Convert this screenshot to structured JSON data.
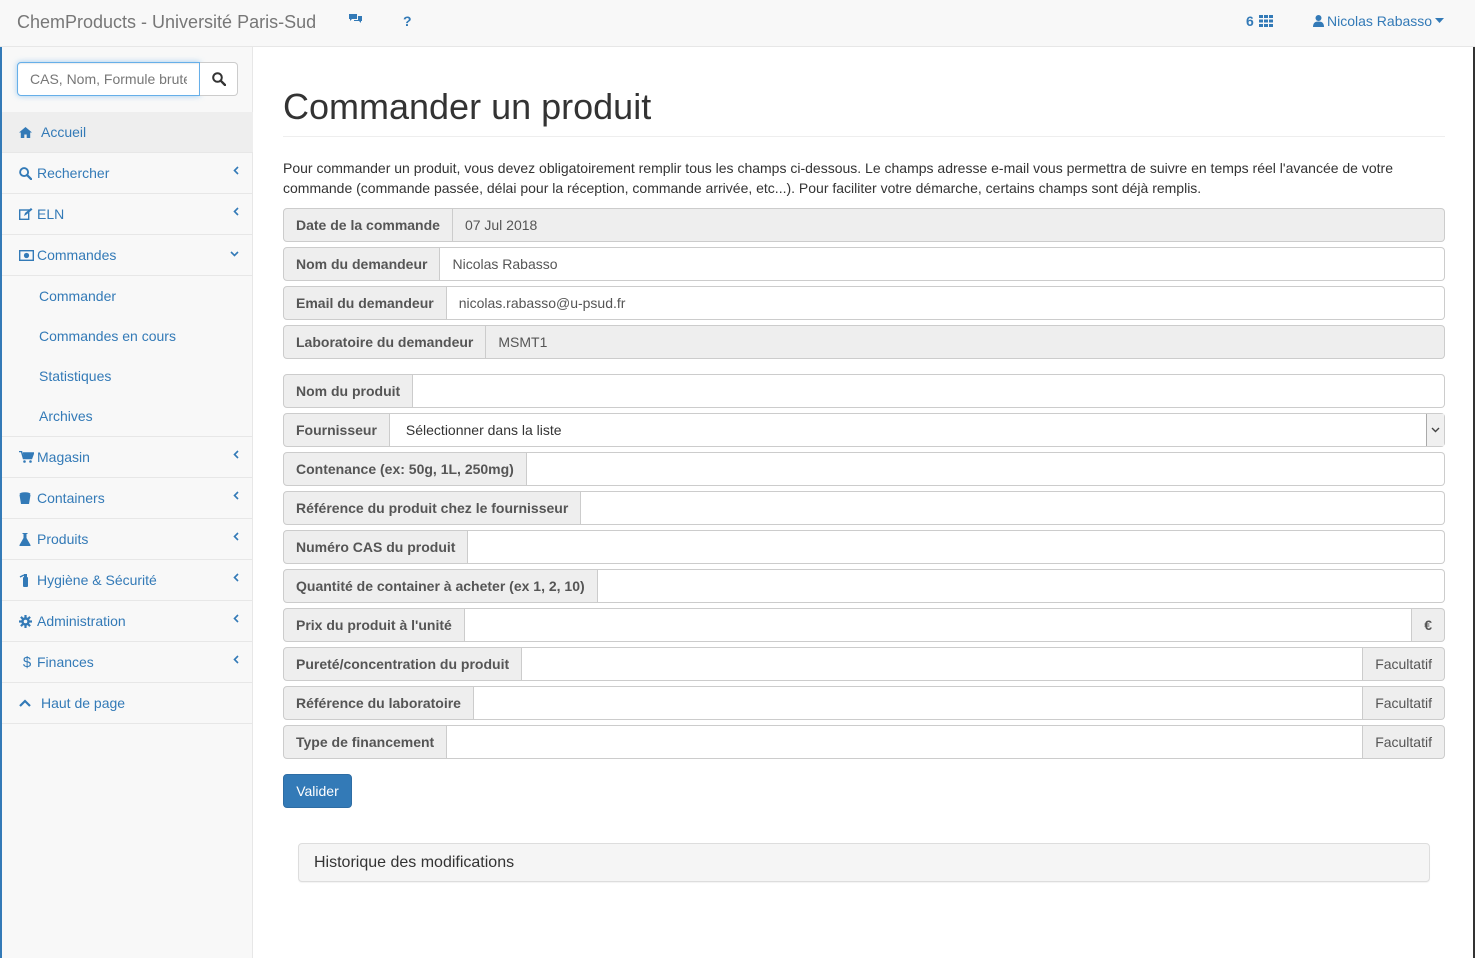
{
  "navbar": {
    "brand": "ChemProducts - Université Paris-Sud",
    "apps_count": "6",
    "user_name": "Nicolas Rabasso",
    "help_label": "?"
  },
  "search": {
    "placeholder": "CAS, Nom, Formule brute"
  },
  "sidebar": {
    "items": [
      {
        "label": "Accueil",
        "icon": "home-icon"
      },
      {
        "label": "Rechercher",
        "icon": "search-icon"
      },
      {
        "label": "ELN",
        "icon": "edit-icon"
      },
      {
        "label": "Commandes",
        "icon": "money-icon"
      },
      {
        "label": "Magasin",
        "icon": "cart-icon"
      },
      {
        "label": "Containers",
        "icon": "bucket-icon"
      },
      {
        "label": "Produits",
        "icon": "flask-icon"
      },
      {
        "label": "Hygiène & Sécurité",
        "icon": "extinguisher-icon"
      },
      {
        "label": "Administration",
        "icon": "gear-icon"
      },
      {
        "label": "Finances",
        "icon": "dollar-icon"
      },
      {
        "label": "Haut de page",
        "icon": "chevron-up-icon"
      }
    ],
    "subitems": [
      "Commander",
      "Commandes en cours",
      "Statistiques",
      "Archives"
    ]
  },
  "main": {
    "title": "Commander un produit",
    "intro": "Pour commander un produit, vous devez obligatoirement remplir tous les champs ci-dessous. Le champs adresse e-mail vous permettra de suivre en temps réel l'avancée de votre commande (commande passée, délai pour la réception, commande arrivée, etc...). Pour faciliter votre démarche, certains champs sont déjà remplis.",
    "fields": {
      "date": {
        "label": "Date de la commande",
        "value": "07 Jul 2018"
      },
      "nom": {
        "label": "Nom du demandeur",
        "value": "Nicolas Rabasso"
      },
      "email": {
        "label": "Email du demandeur",
        "value": "nicolas.rabasso@u-psud.fr"
      },
      "labo": {
        "label": "Laboratoire du demandeur",
        "value": "MSMT1"
      },
      "produit": {
        "label": "Nom du produit",
        "value": ""
      },
      "fournisseur": {
        "label": "Fournisseur",
        "value": "Sélectionner dans la liste"
      },
      "contenance": {
        "label": "Contenance (ex: 50g, 1L, 250mg)",
        "value": ""
      },
      "ref_fournisseur": {
        "label": "Référence du produit chez le fournisseur",
        "value": ""
      },
      "cas": {
        "label": "Numéro CAS du produit",
        "value": ""
      },
      "quantite": {
        "label": "Quantité de container à acheter (ex 1, 2, 10)",
        "value": ""
      },
      "prix": {
        "label": "Prix du produit à l'unité",
        "value": "",
        "addon": "€"
      },
      "purete": {
        "label": "Pureté/concentration du produit",
        "value": "",
        "addon": "Facultatif"
      },
      "ref_labo": {
        "label": "Référence du laboratoire",
        "value": "",
        "addon": "Facultatif"
      },
      "financement": {
        "label": "Type de financement",
        "value": "",
        "addon": "Facultatif"
      }
    },
    "submit_label": "Valider",
    "history_title": "Historique des modifications"
  },
  "colors": {
    "link": "#337ab7",
    "addon_bg": "#eeeeee",
    "border": "#cccccc"
  }
}
